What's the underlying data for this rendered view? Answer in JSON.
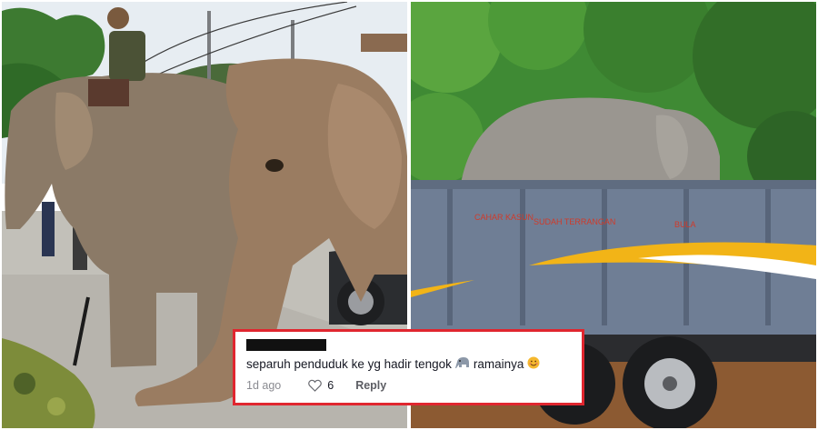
{
  "comment": {
    "text_before_emoji": "separuh penduduk ke yg hadir tengok",
    "text_after_emoji": "ramainya",
    "emoji_1": "elephant-emoji",
    "emoji_2": "smiling-face-emoji",
    "time": "1d ago",
    "like_count": "6",
    "reply_label": "Reply"
  },
  "truck": {
    "panel_texts": [
      "CAHAR KASUN",
      "SUDAH TERRANGAN",
      "BULA"
    ],
    "body_color": "#6f7e95",
    "stripe_colors": [
      "#f2b417",
      "#ffffff"
    ]
  },
  "colors": {
    "highlight_border": "#e0262f",
    "sky": "#dfe7ee",
    "foliage": "#3f8a34"
  }
}
